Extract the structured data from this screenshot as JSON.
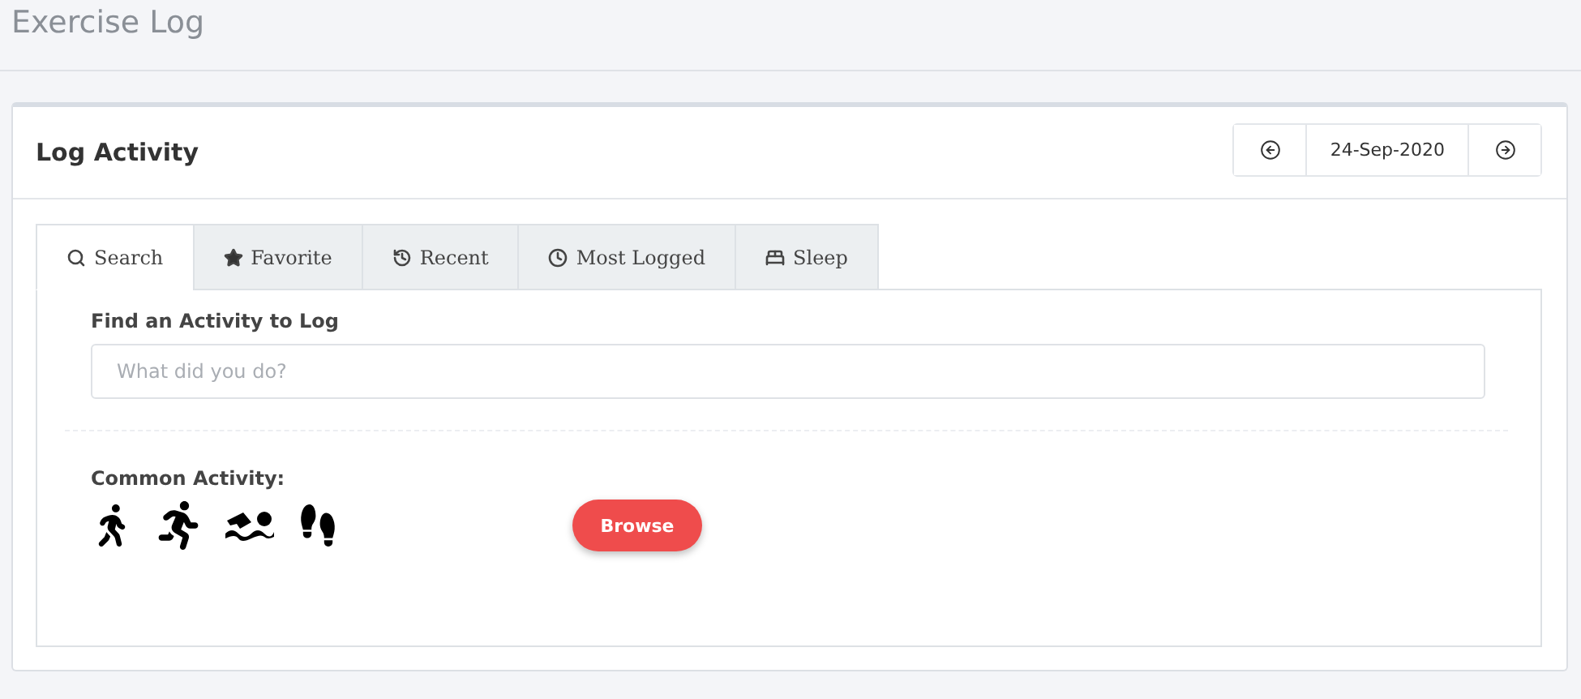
{
  "page_title": "Exercise Log",
  "card": {
    "title": "Log Activity",
    "date": "24-Sep-2020"
  },
  "tabs": [
    {
      "label": "Search",
      "selected": true
    },
    {
      "label": "Favorite",
      "selected": false
    },
    {
      "label": "Recent",
      "selected": false
    },
    {
      "label": "Most Logged",
      "selected": false
    },
    {
      "label": "Sleep",
      "selected": false
    }
  ],
  "search": {
    "label": "Find an Activity to Log",
    "placeholder": "What did you do?"
  },
  "common": {
    "label": "Common Activity:",
    "button": "Browse"
  }
}
